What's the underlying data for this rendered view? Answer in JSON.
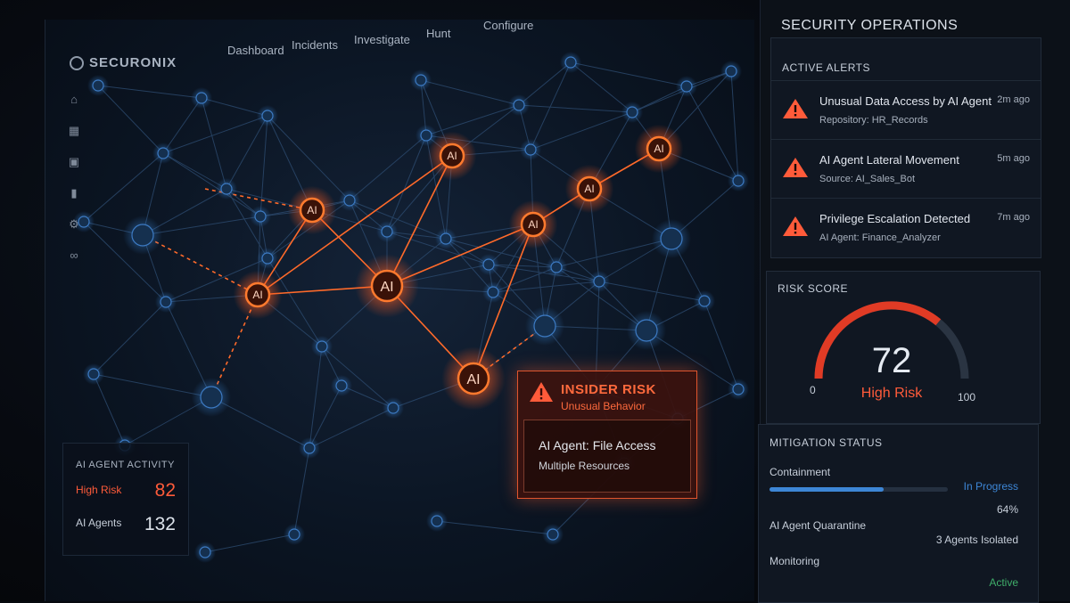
{
  "brand": {
    "name": "SECURONIX"
  },
  "nav": {
    "items": [
      "Dashboard",
      "Incidents",
      "Investigate",
      "Hunt",
      "Configure"
    ]
  },
  "sidebar": {
    "icons": [
      "home-icon",
      "grid-icon",
      "layers-icon",
      "bar-chart-icon",
      "settings-icon",
      "link-icon"
    ]
  },
  "network": {
    "node_label": "AI"
  },
  "activity": {
    "title": "AI AGENT ACTIVITY",
    "high_risk_label": "High Risk",
    "high_risk_value": "82",
    "agents_label": "AI Agents",
    "agents_value": "132"
  },
  "insider": {
    "title": "INSIDER RISK",
    "subtitle": "Unusual Behavior",
    "detail": "AI Agent: File Access",
    "detail_sub": "Multiple Resources"
  },
  "panel": {
    "title": "SECURITY OPERATIONS",
    "alerts": {
      "heading": "ACTIVE ALERTS",
      "items": [
        {
          "name": "Unusual Data Access by AI Agent",
          "sub": "Repository: HR_Records",
          "time": "2m ago"
        },
        {
          "name": "AI Agent Lateral Movement",
          "sub": "Source: AI_Sales_Bot",
          "time": "5m ago"
        },
        {
          "name": "Privilege Escalation Detected",
          "sub": "AI Agent: Finance_Analyzer",
          "time": "7m ago"
        }
      ]
    },
    "risk": {
      "heading": "RISK SCORE",
      "value": "72",
      "label": "High Risk",
      "min": "0",
      "max": "100"
    },
    "mitigation": {
      "heading": "MITIGATION STATUS",
      "containment_label": "Containment",
      "containment_status": "In Progress",
      "containment_percent": "64%",
      "containment_fraction": 0.64,
      "quarantine_label": "AI Agent Quarantine",
      "quarantine_status": "3 Agents Isolated",
      "monitoring_label": "Monitoring",
      "monitoring_status": "Active"
    }
  },
  "colors": {
    "alert": "#ff5b3a",
    "accent_blue": "#3d86d6",
    "active_green": "#3fae6a",
    "node_orange": "#ff7a2e",
    "node_blue": "#2f6fb5"
  }
}
